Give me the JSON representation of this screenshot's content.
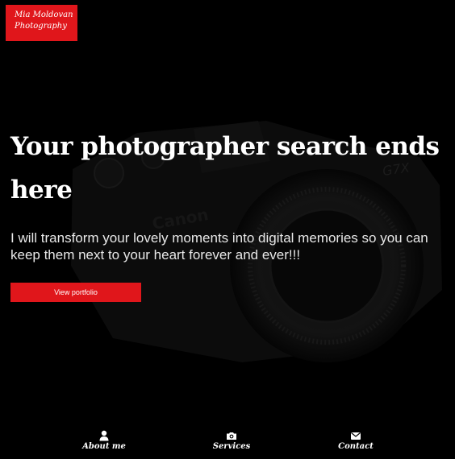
{
  "brand": {
    "line1": "Mia Moldovan",
    "line2": "Photography"
  },
  "hero": {
    "headline": "Your photographer search ends here",
    "subtitle": "I will transform your lovely moments into digital memories so you can keep them next to your heart forever and ever!!!",
    "cta_label": "View portfolio"
  },
  "nav": {
    "items": [
      {
        "label": "About me",
        "icon": "user-icon"
      },
      {
        "label": "Services",
        "icon": "camera-icon"
      },
      {
        "label": "Contact",
        "icon": "envelope-icon"
      }
    ]
  },
  "colors": {
    "accent": "#e0161b",
    "background": "#000000",
    "text": "#ffffff"
  }
}
